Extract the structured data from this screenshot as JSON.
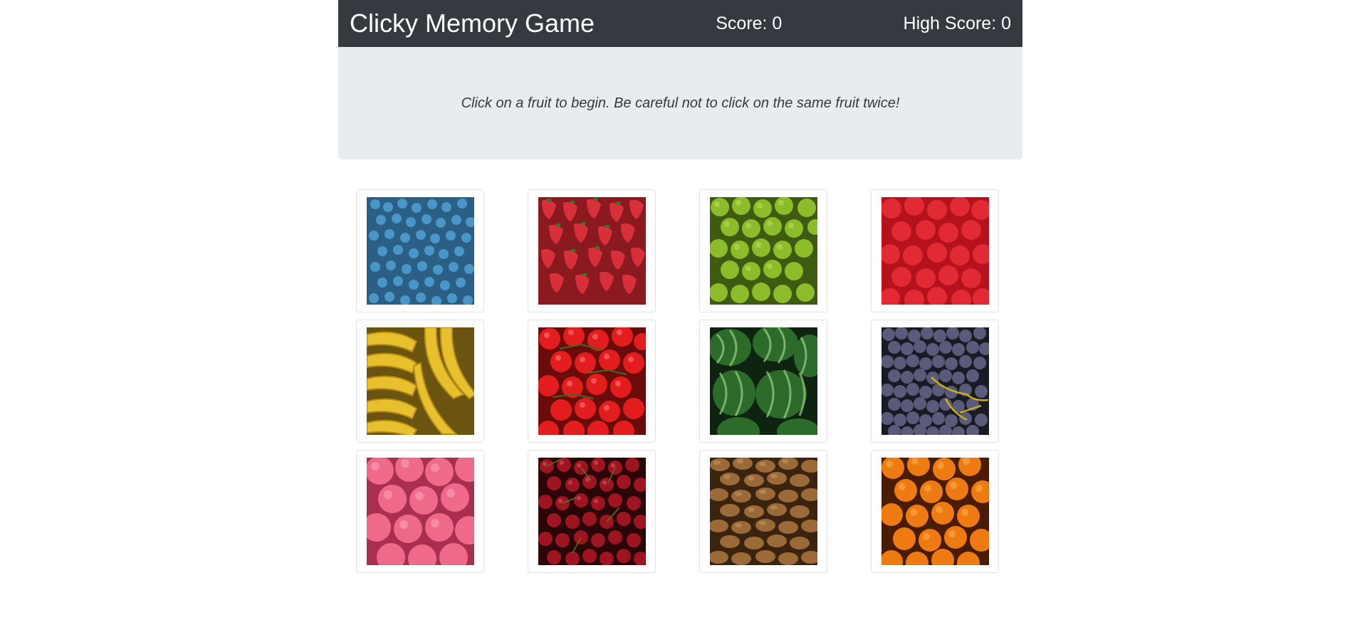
{
  "header": {
    "title": "Clicky Memory Game",
    "score_text": "Score: 0",
    "high_score_text": "High Score: 0"
  },
  "jumbotron": {
    "instructions": "Click on a fruit to begin. Be careful not to click on the same fruit twice!"
  },
  "cards": [
    {
      "icon": "blueberries-icon"
    },
    {
      "icon": "strawberries-icon"
    },
    {
      "icon": "green-apples-icon"
    },
    {
      "icon": "raspberries-icon"
    },
    {
      "icon": "bananas-icon"
    },
    {
      "icon": "tomatoes-icon"
    },
    {
      "icon": "watermelons-icon"
    },
    {
      "icon": "grapes-icon"
    },
    {
      "icon": "lychees-icon"
    },
    {
      "icon": "cherries-icon"
    },
    {
      "icon": "kiwis-icon"
    },
    {
      "icon": "oranges-icon"
    }
  ],
  "colors": {
    "navbar": "#343a40",
    "jumbotron": "#e9ecef"
  }
}
